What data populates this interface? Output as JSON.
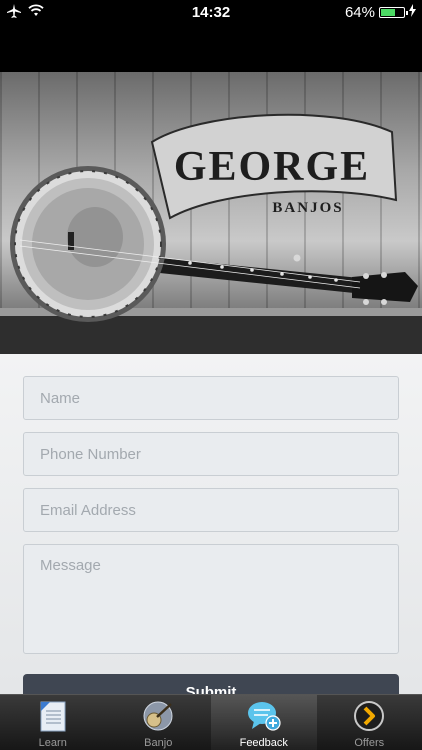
{
  "status_bar": {
    "time": "14:32",
    "battery_percent": "64%",
    "battery_level": 0.64
  },
  "hero": {
    "logo_title": "GEORGE",
    "logo_subtitle": "BANJOS"
  },
  "form": {
    "name_placeholder": "Name",
    "phone_placeholder": "Phone Number",
    "email_placeholder": "Email Address",
    "message_placeholder": "Message",
    "submit_label": "Submit"
  },
  "tabs": [
    {
      "label": "Learn",
      "icon": "document-icon",
      "active": false
    },
    {
      "label": "Banjo",
      "icon": "banjo-icon",
      "active": false
    },
    {
      "label": "Feedback",
      "icon": "speech-bubble-add-icon",
      "active": true
    },
    {
      "label": "Offers",
      "icon": "chevron-right-circle-icon",
      "active": false
    }
  ],
  "colors": {
    "tab_active": "#ffffff",
    "tab_inactive": "#9a9a9a",
    "submit_bg": "#3f4652",
    "battery": "#4cd964"
  }
}
